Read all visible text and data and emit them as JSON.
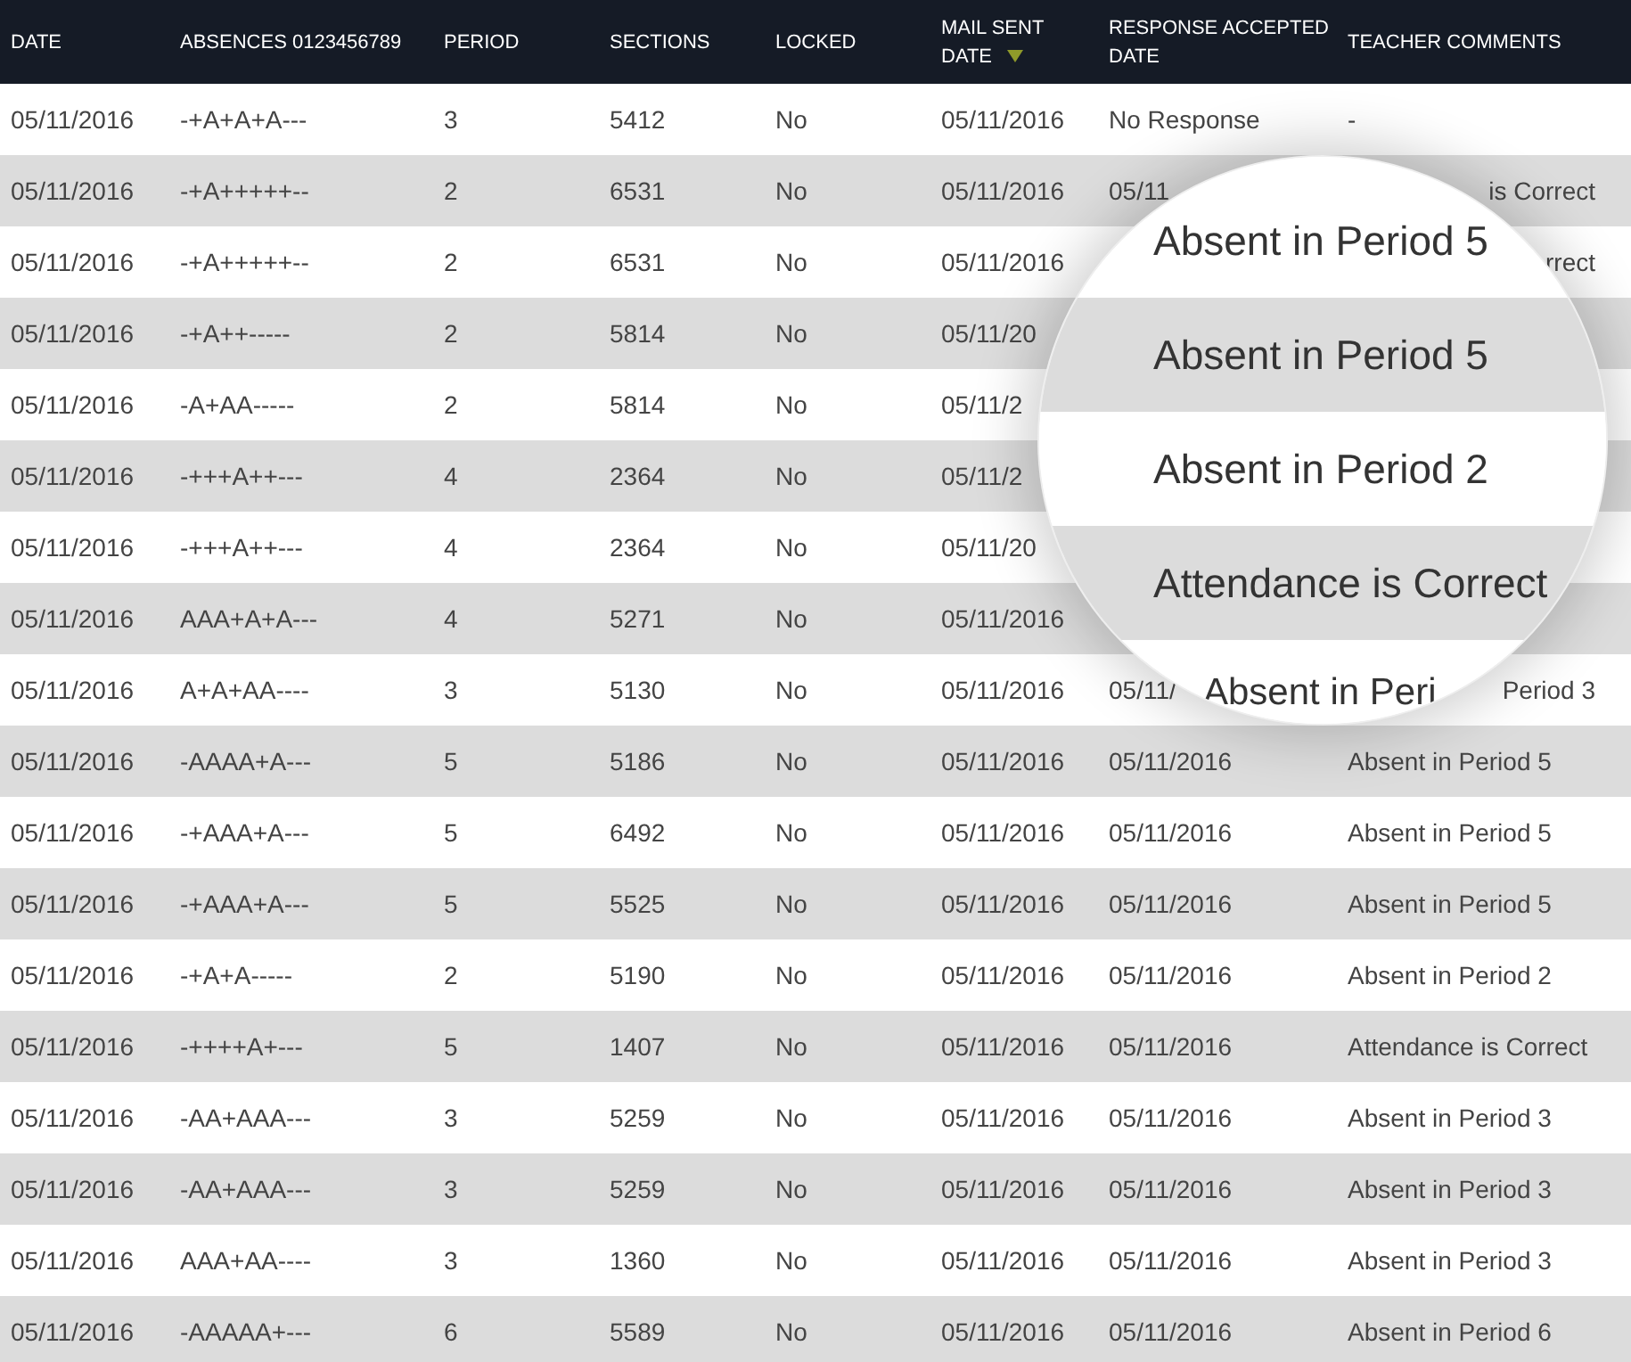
{
  "table": {
    "columns": [
      {
        "label": "DATE",
        "sorted": false
      },
      {
        "label": "ABSENCES 0123456789",
        "sorted": false
      },
      {
        "label": "PERIOD",
        "sorted": false
      },
      {
        "label": "SECTIONS",
        "sorted": false
      },
      {
        "label": "LOCKED",
        "sorted": false
      },
      {
        "label": "MAIL SENT DATE",
        "sorted": true
      },
      {
        "label": "RESPONSE ACCEPTED DATE",
        "sorted": false
      },
      {
        "label": "TEACHER COMMENTS",
        "sorted": false
      }
    ],
    "rows": [
      {
        "date": "05/11/2016",
        "absences": "-+A+A+A---",
        "period": "3",
        "sections": "5412",
        "locked": "No",
        "mail_sent_date": "05/11/2016",
        "response_accepted_date": "No Response",
        "teacher_comments": "-"
      },
      {
        "date": "05/11/2016",
        "absences": "-+A+++++--",
        "period": "2",
        "sections": "6531",
        "locked": "No",
        "mail_sent_date": "05/11/2016",
        "response_accepted_date": "05/11",
        "teacher_comments": "is Correct"
      },
      {
        "date": "05/11/2016",
        "absences": "-+A+++++--",
        "period": "2",
        "sections": "6531",
        "locked": "No",
        "mail_sent_date": "05/11/2016",
        "teacher_comments": "rrect"
      },
      {
        "date": "05/11/2016",
        "absences": "-+A++-----",
        "period": "2",
        "sections": "5814",
        "locked": "No",
        "mail_sent_date": "05/11/20"
      },
      {
        "date": "05/11/2016",
        "absences": "-A+AA-----",
        "period": "2",
        "sections": "5814",
        "locked": "No",
        "mail_sent_date": "05/11/2"
      },
      {
        "date": "05/11/2016",
        "absences": "-+++A++---",
        "period": "4",
        "sections": "2364",
        "locked": "No",
        "mail_sent_date": "05/11/2"
      },
      {
        "date": "05/11/2016",
        "absences": "-+++A++---",
        "period": "4",
        "sections": "2364",
        "locked": "No",
        "mail_sent_date": "05/11/20"
      },
      {
        "date": "05/11/2016",
        "absences": "AAA+A+A---",
        "period": "4",
        "sections": "5271",
        "locked": "No",
        "mail_sent_date": "05/11/2016"
      },
      {
        "date": "05/11/2016",
        "absences": "A+A+AA----",
        "period": "3",
        "sections": "5130",
        "locked": "No",
        "mail_sent_date": "05/11/2016",
        "response_accepted_date": "05/11/",
        "teacher_comments": "Period 3"
      },
      {
        "date": "05/11/2016",
        "absences": "-AAAA+A---",
        "period": "5",
        "sections": "5186",
        "locked": "No",
        "mail_sent_date": "05/11/2016",
        "response_accepted_date": "05/11/2016",
        "teacher_comments": "Absent in Period 5"
      },
      {
        "date": "05/11/2016",
        "absences": "-+AAA+A---",
        "period": "5",
        "sections": "6492",
        "locked": "No",
        "mail_sent_date": "05/11/2016",
        "response_accepted_date": "05/11/2016",
        "teacher_comments": "Absent in Period 5"
      },
      {
        "date": "05/11/2016",
        "absences": "-+AAA+A---",
        "period": "5",
        "sections": "5525",
        "locked": "No",
        "mail_sent_date": "05/11/2016",
        "response_accepted_date": "05/11/2016",
        "teacher_comments": "Absent in Period 5"
      },
      {
        "date": "05/11/2016",
        "absences": "-+A+A-----",
        "period": "2",
        "sections": "5190",
        "locked": "No",
        "mail_sent_date": "05/11/2016",
        "response_accepted_date": "05/11/2016",
        "teacher_comments": "Absent in Period 2"
      },
      {
        "date": "05/11/2016",
        "absences": "-++++A+---",
        "period": "5",
        "sections": "1407",
        "locked": "No",
        "mail_sent_date": "05/11/2016",
        "response_accepted_date": "05/11/2016",
        "teacher_comments": "Attendance is Correct"
      },
      {
        "date": "05/11/2016",
        "absences": "-AA+AAA---",
        "period": "3",
        "sections": "5259",
        "locked": "No",
        "mail_sent_date": "05/11/2016",
        "response_accepted_date": "05/11/2016",
        "teacher_comments": "Absent in Period 3"
      },
      {
        "date": "05/11/2016",
        "absences": "-AA+AAA---",
        "period": "3",
        "sections": "5259",
        "locked": "No",
        "mail_sent_date": "05/11/2016",
        "response_accepted_date": "05/11/2016",
        "teacher_comments": "Absent in Period 3"
      },
      {
        "date": "05/11/2016",
        "absences": "AAA+AA----",
        "period": "3",
        "sections": "1360",
        "locked": "No",
        "mail_sent_date": "05/11/2016",
        "response_accepted_date": "05/11/2016",
        "teacher_comments": "Absent in Period 3"
      },
      {
        "date": "05/11/2016",
        "absences": "-AAAAA+---",
        "period": "6",
        "sections": "5589",
        "locked": "No",
        "mail_sent_date": "05/11/2016",
        "response_accepted_date": "05/11/2016",
        "teacher_comments": "Absent in Period 6"
      }
    ]
  },
  "magnifier": {
    "rows": [
      "Absent in Period 5",
      "Absent in Period 5",
      "Absent in Period 2",
      "Attendance is Correct",
      "Absent in Peri"
    ]
  }
}
